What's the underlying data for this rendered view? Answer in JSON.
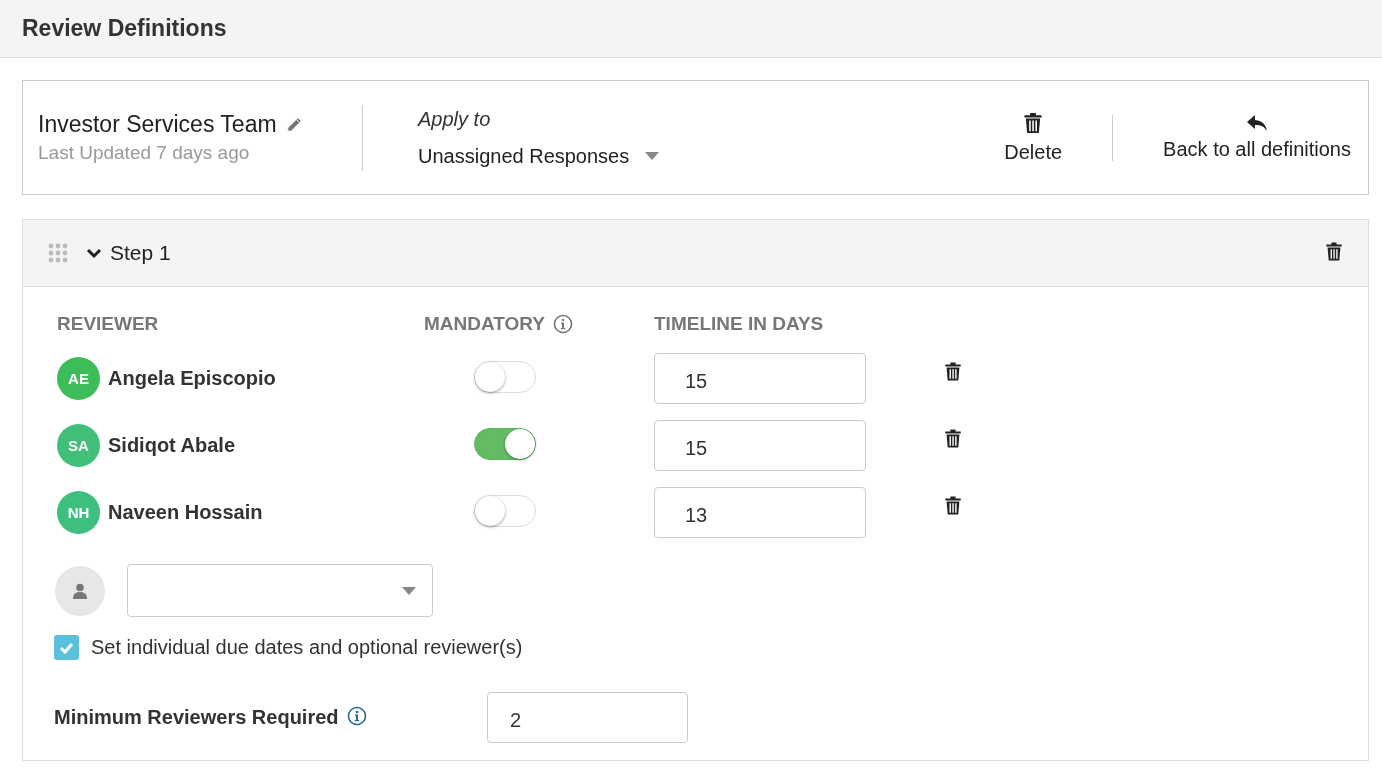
{
  "page_title": "Review Definitions",
  "definition": {
    "name": "Investor Services Team",
    "updated": "Last Updated 7 days ago",
    "apply_to_label": "Apply to",
    "apply_to_value": "Unassigned Responses",
    "actions": [
      {
        "kind": "delete",
        "label": "Delete"
      },
      {
        "kind": "back",
        "label": "Back to all definitions"
      }
    ]
  },
  "step": {
    "title": "Step 1",
    "expanded": true,
    "columns": [
      {
        "label": "REVIEWER",
        "info": false
      },
      {
        "label": "MANDATORY",
        "info": true
      },
      {
        "label": "TIMELINE IN DAYS",
        "info": false
      }
    ],
    "reviewers": [
      {
        "initials": "AE",
        "name": "Angela Episcopio",
        "color": "#3cbd5a",
        "mandatory": false,
        "timeline": "15"
      },
      {
        "initials": "SA",
        "name": "Sidiqot Abale",
        "color": "#40bf78",
        "mandatory": true,
        "timeline": "15"
      },
      {
        "initials": "NH",
        "name": "Naveen Hossain",
        "color": "#3dbf80",
        "mandatory": false,
        "timeline": "13"
      }
    ],
    "individual_due_dates": {
      "label": "Set individual due dates and optional reviewer(s)",
      "checked": true
    },
    "min_reviewers": {
      "label": "Minimum Reviewers Required",
      "value": "2"
    }
  }
}
